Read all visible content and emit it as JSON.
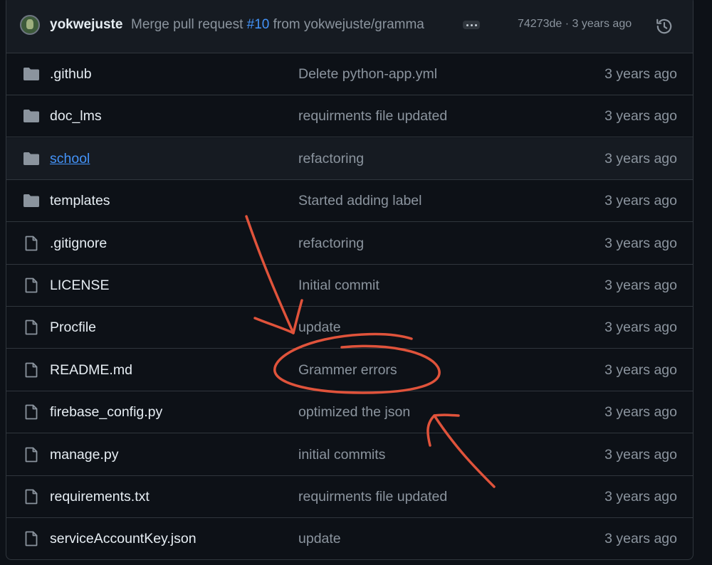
{
  "commit": {
    "author": "yokwejuste",
    "message_prefix": "Merge pull request ",
    "pr_number": "#10",
    "message_suffix": " from yokwejuste/gramma",
    "sha_time": "74273de · 3 years ago",
    "more_icon": "ellipsis-icon",
    "history_icon": "history-icon"
  },
  "files": [
    {
      "name": ".github",
      "type": "folder",
      "message": "Delete python-app.yml",
      "age": "3 years ago"
    },
    {
      "name": "doc_lms",
      "type": "folder",
      "message": "requirments file updated",
      "age": "3 years ago"
    },
    {
      "name": "school",
      "type": "folder",
      "message": "refactoring",
      "age": "3 years ago"
    },
    {
      "name": "templates",
      "type": "folder",
      "message": "Started adding label",
      "age": "3 years ago"
    },
    {
      "name": ".gitignore",
      "type": "file",
      "message": "refactoring",
      "age": "3 years ago"
    },
    {
      "name": "LICENSE",
      "type": "file",
      "message": "Initial commit",
      "age": "3 years ago"
    },
    {
      "name": "Procfile",
      "type": "file",
      "message": "update",
      "age": "3 years ago"
    },
    {
      "name": "README.md",
      "type": "file",
      "message": "Grammer errors",
      "age": "3 years ago"
    },
    {
      "name": "firebase_config.py",
      "type": "file",
      "message": "optimized the json",
      "age": "3 years ago"
    },
    {
      "name": "manage.py",
      "type": "file",
      "message": "initial commits",
      "age": "3 years ago"
    },
    {
      "name": "requirements.txt",
      "type": "file",
      "message": "requirments file updated",
      "age": "3 years ago"
    },
    {
      "name": "serviceAccountKey.json",
      "type": "file",
      "message": "update",
      "age": "3 years ago"
    }
  ],
  "colors": {
    "background": "#0d1117",
    "header": "#161b22",
    "border": "#30363d",
    "link": "#4493f8",
    "muted": "#8b949e",
    "annotation": "#e0533b"
  }
}
